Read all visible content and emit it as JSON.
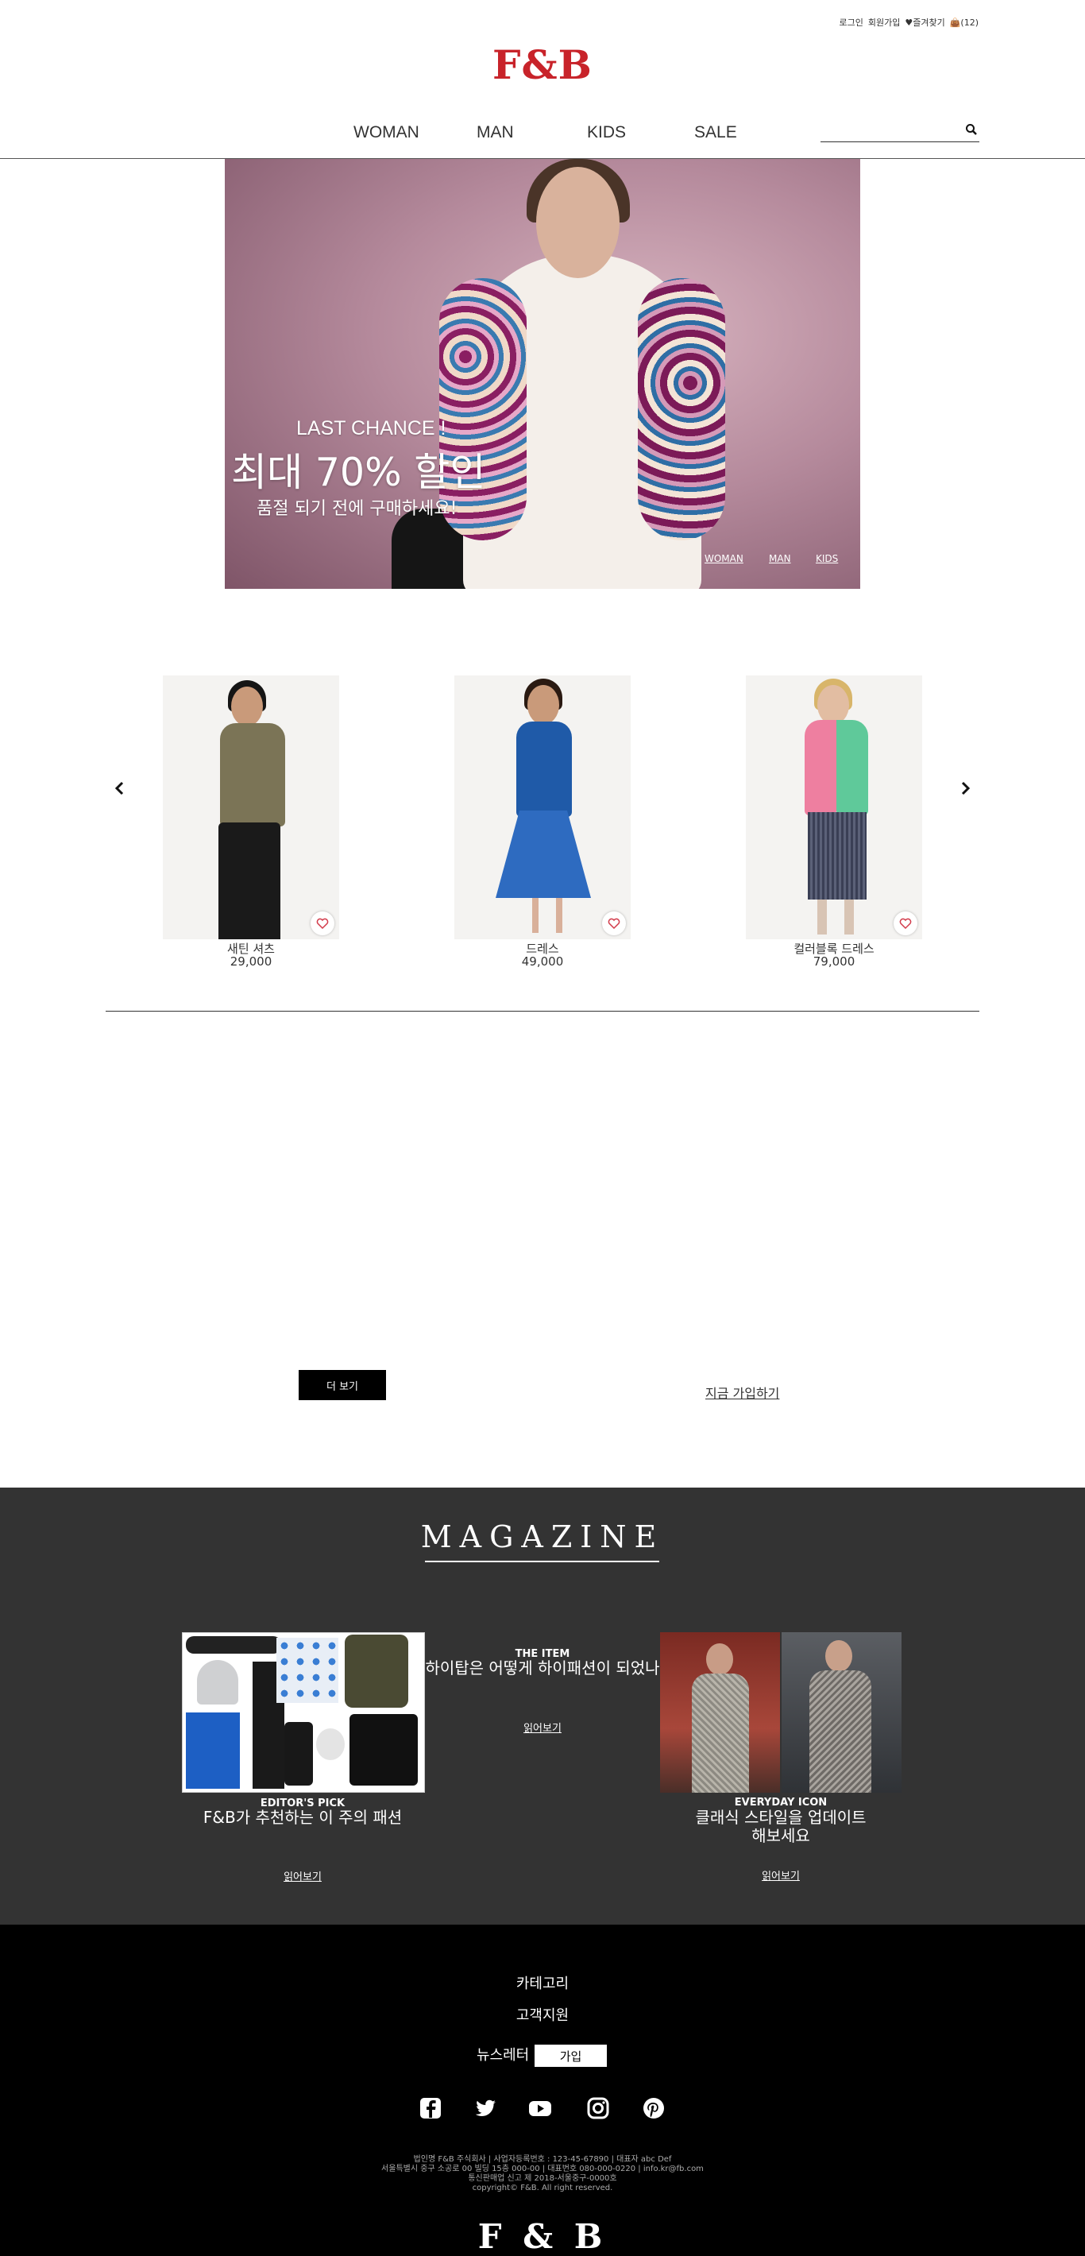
{
  "header": {
    "top_links": {
      "login": "로그인",
      "signup": "회원가입",
      "wishlist": "즐겨찾기",
      "cart_count": "(12)"
    },
    "logo": "F&B",
    "nav": [
      "WOMAN",
      "MAN",
      "KIDS",
      "SALE"
    ],
    "search": {
      "placeholder": "",
      "value": ""
    }
  },
  "hero": {
    "subtitle": "LAST CHANCE !",
    "title": "최대 70% 할인",
    "description": "품절 되기 전에 구매하세요!",
    "links": [
      "WOMAN",
      "MAN",
      "KIDS"
    ]
  },
  "products": [
    {
      "name": "새틴 셔츠",
      "price": "29,000"
    },
    {
      "name": "드레스",
      "price": "49,000"
    },
    {
      "name": "컬러블록 드레스",
      "price": "79,000"
    }
  ],
  "actions": {
    "more_label": "더 보기",
    "signup_label": "지금 가입하기"
  },
  "magazine": {
    "title": "MAGAZINE",
    "articles": [
      {
        "kicker": "EDITOR'S PICK",
        "headline": "F&B가 추천하는 이 주의 패션",
        "read": "읽어보기"
      },
      {
        "kicker": "THE ITEM",
        "headline": "하이탑은 어떻게 하이패션이 되었나",
        "read": "읽어보기"
      },
      {
        "kicker": "EVERYDAY ICON",
        "headline": "클래식 스타일을 업데이트",
        "headline2": "해보세요",
        "read": "읽어보기"
      }
    ]
  },
  "footer": {
    "links": [
      "카테고리",
      "고객지원"
    ],
    "newsletter_label": "뉴스레터",
    "newsletter_button": "가입",
    "social_icons": [
      "facebook-icon",
      "twitter-icon",
      "youtube-icon",
      "instagram-icon",
      "pinterest-icon"
    ],
    "info_lines": [
      "법인명 F&B 주식회사 | 사업자등록번호 : 123-45-67890 | 대표자 abc Def",
      "서울특별시 중구 소공로 00 빌딩 15층 000-00 | 대표번호 080-000-0220 | info.kr@fb.com",
      "통신판매업 신고 제 2018-서울중구-0000호",
      "copyright© F&B. All right reserved."
    ],
    "logo": "F & B"
  },
  "colors": {
    "brand_red": "#c8232a",
    "magazine_bg": "#333333",
    "footer_bg": "#000000"
  }
}
